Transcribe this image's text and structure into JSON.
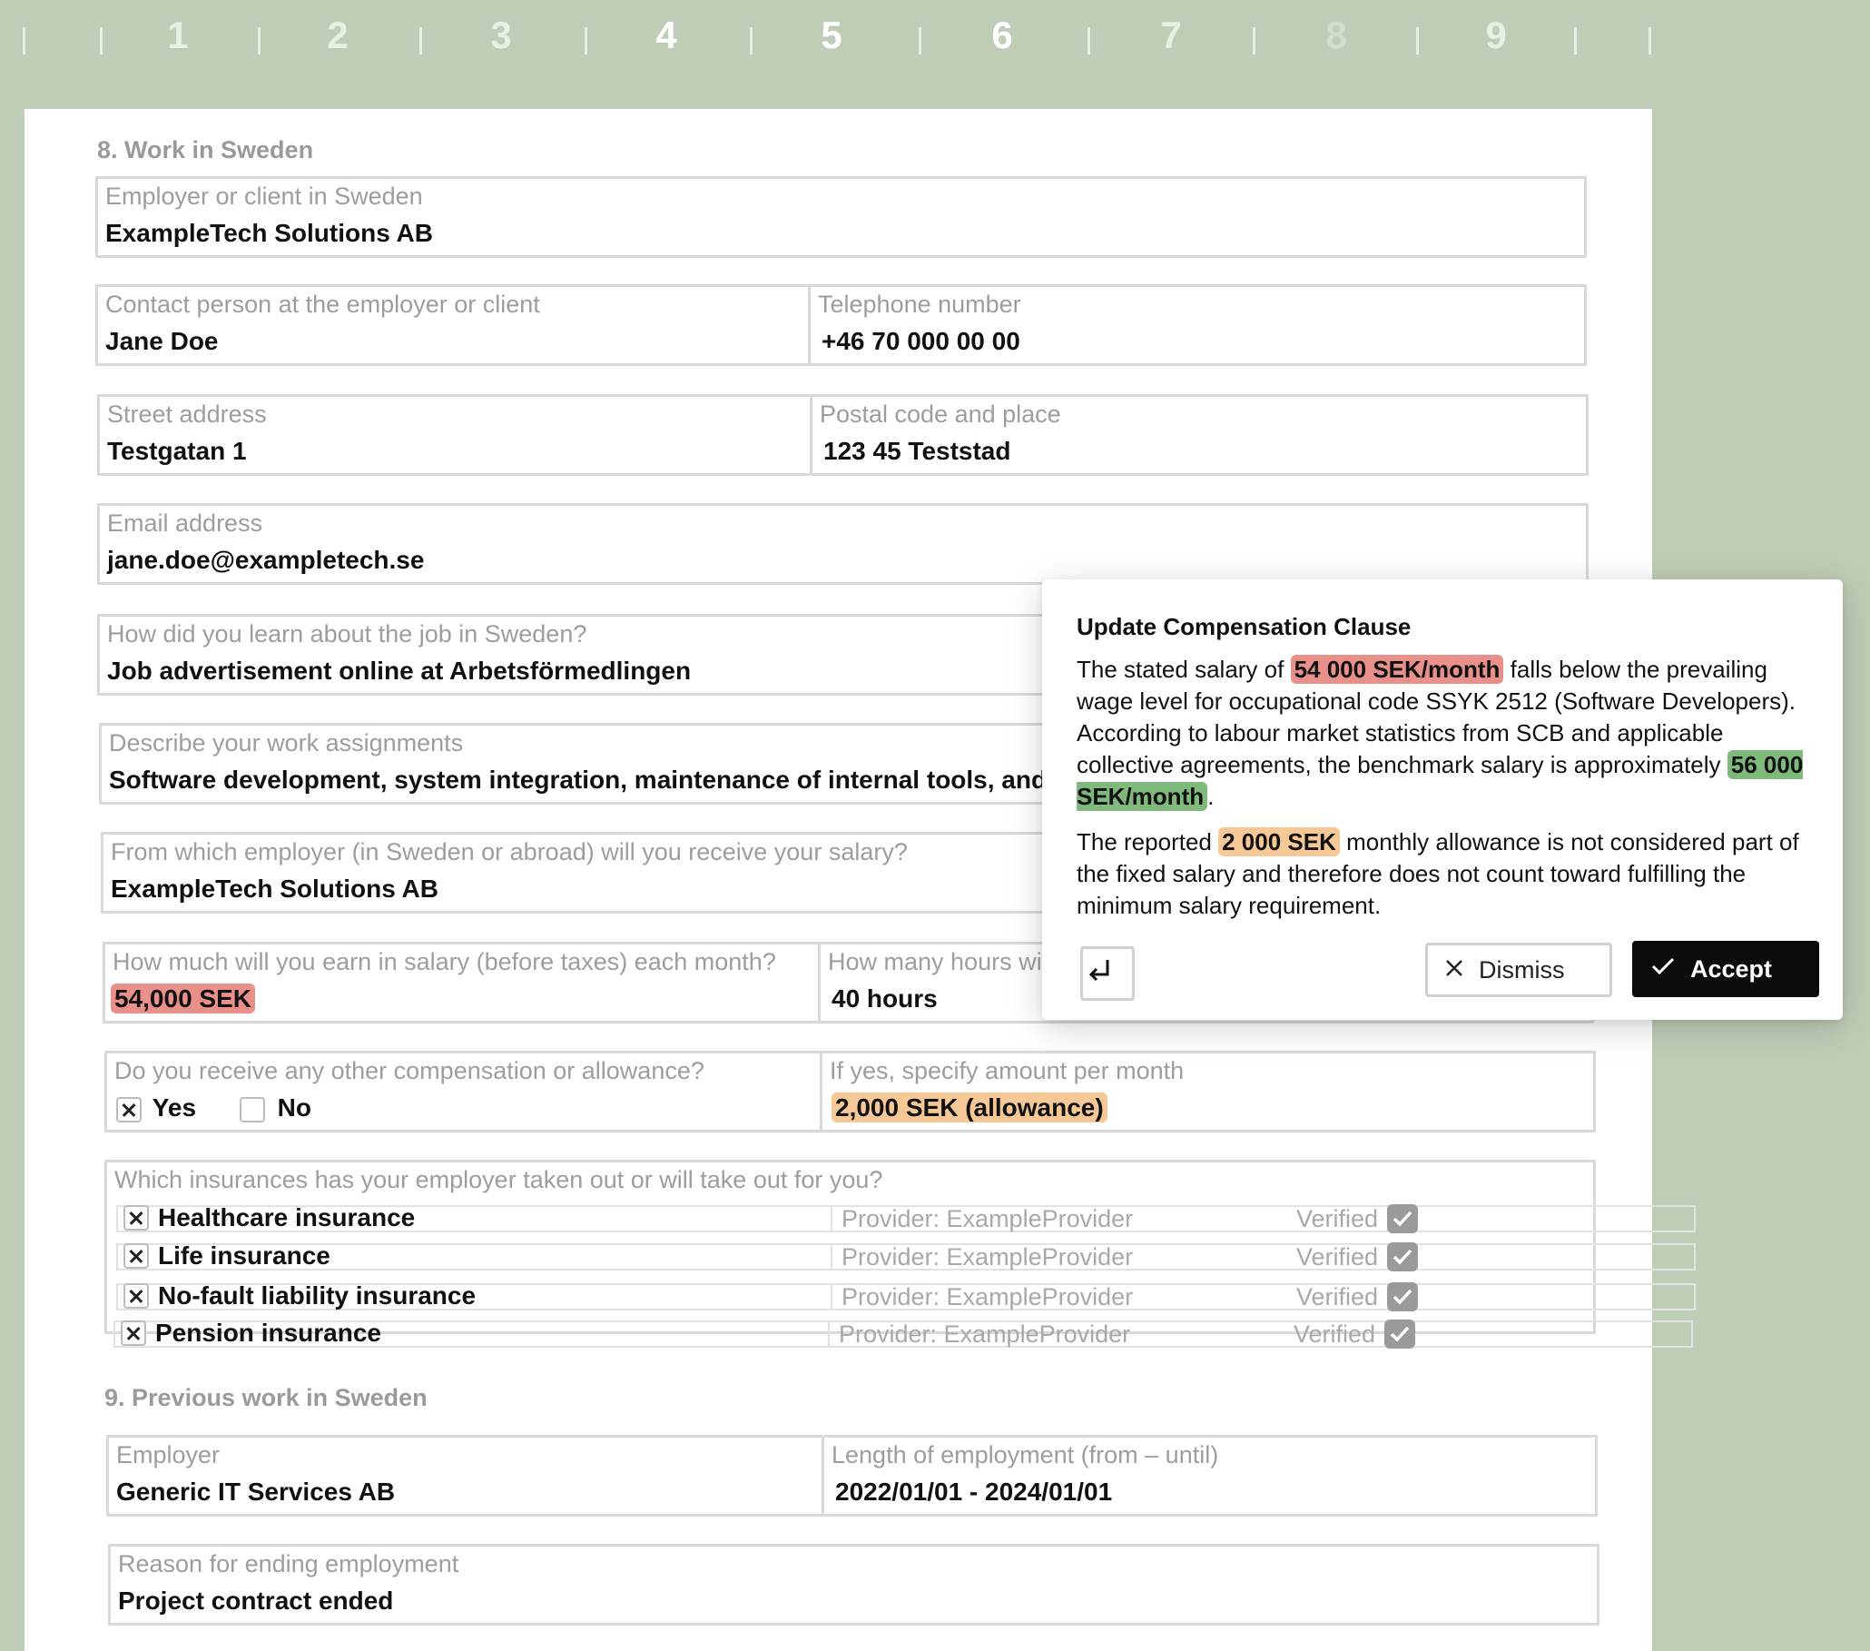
{
  "ruler": {
    "pages": [
      "1",
      "2",
      "3",
      "4",
      "5",
      "6",
      "7",
      "8",
      "9"
    ]
  },
  "section8": {
    "title": "8. Work in Sweden",
    "employer": {
      "label": "Employer or client in Sweden",
      "value": "ExampleTech Solutions AB"
    },
    "contact": {
      "label": "Contact person at the employer or client",
      "value": "Jane Doe"
    },
    "phone": {
      "label": "Telephone number",
      "value": "+46 70 000 00 00"
    },
    "street": {
      "label": "Street address",
      "value": "Testgatan 1"
    },
    "postal": {
      "label": "Postal code and place",
      "value": "123 45 Teststad"
    },
    "email": {
      "label": "Email address",
      "value": "jane.doe@exampletech.se"
    },
    "learn": {
      "label": "How did you learn about the job in Sweden?",
      "value": "Job advertisement online at Arbetsförmedlingen"
    },
    "assignments": {
      "label": "Describe your work assignments",
      "value": "Software development, system integration, maintenance of internal tools, and par"
    },
    "salary_from": {
      "label": "From which employer (in Sweden or abroad) will you receive your salary?",
      "value": "ExampleTech Solutions AB"
    },
    "salary": {
      "label": "How much will you earn in salary (before taxes) each month?",
      "value": "54,000 SEK"
    },
    "hours": {
      "label": "How many hours wi",
      "value": "40 hours"
    },
    "other_comp": {
      "label": "Do you receive any other compensation or allowance?",
      "yes": "Yes",
      "no": "No",
      "yes_checked": true
    },
    "other_amount": {
      "label": "If yes, specify amount per month",
      "value": "2,000 SEK (allowance)"
    },
    "insurances": {
      "label": "Which insurances has your employer taken out or will take out for you?",
      "rows": [
        {
          "name": "Healthcare insurance",
          "provider": "Provider: ExampleProvider",
          "status": "Verified"
        },
        {
          "name": "Life insurance",
          "provider": "Provider: ExampleProvider",
          "status": "Verified"
        },
        {
          "name": "No-fault liability insurance",
          "provider": "Provider: ExampleProvider",
          "status": "Verified"
        },
        {
          "name": "Pension insurance",
          "provider": "Provider: ExampleProvider",
          "status": "Verified"
        }
      ]
    }
  },
  "section9": {
    "title": "9. Previous work in Sweden",
    "employer": {
      "label": "Employer",
      "value": "Generic IT Services AB"
    },
    "length": {
      "label": "Length of employment (from – until)",
      "value": "2022/01/01 - 2024/01/01"
    },
    "reason": {
      "label": "Reason for ending employment",
      "value": "Project contract ended"
    }
  },
  "popup": {
    "title": "Update Compensation Clause",
    "p1_a": "The stated salary of",
    "p1_hl1": "54 000 SEK/month",
    "p1_b": "falls below the prevailing wage level for occupational code SSYK 2512 (Software Developers). According to labour market statistics from SCB and applicable collective agreements, the benchmark salary is approximately",
    "p1_hl2": "56 000 SEK/month",
    "p1_c": ".",
    "p2_a": "The reported",
    "p2_hl": "2 000 SEK",
    "p2_b": "monthly allowance is not considered part of the fixed salary and therefore does not count toward fulfilling the minimum salary requirement.",
    "dismiss": "Dismiss",
    "accept": "Accept"
  },
  "colors": {
    "background": "#bfcdb6",
    "highlight_red": "#e9908b",
    "highlight_orange": "#f6c896",
    "highlight_green": "#7fb97c",
    "accept_button": "#0b0b0b"
  }
}
